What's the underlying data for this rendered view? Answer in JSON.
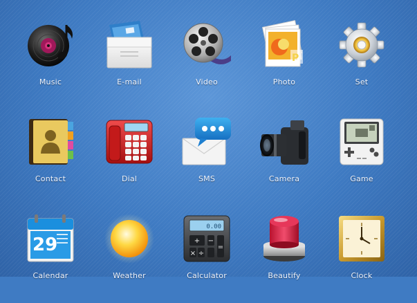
{
  "apps": [
    {
      "label": "Music",
      "icon": "music-disc-icon"
    },
    {
      "label": "E-mail",
      "icon": "envelope-icon"
    },
    {
      "label": "Video",
      "icon": "film-reel-icon"
    },
    {
      "label": "Photo",
      "icon": "photo-stack-icon"
    },
    {
      "label": "Set",
      "icon": "gear-icon"
    },
    {
      "label": "Contact",
      "icon": "address-book-icon"
    },
    {
      "label": "Dial",
      "icon": "telephone-icon"
    },
    {
      "label": "SMS",
      "icon": "message-bubble-icon"
    },
    {
      "label": "Camera",
      "icon": "camera-icon"
    },
    {
      "label": "Game",
      "icon": "handheld-console-icon"
    },
    {
      "label": "Calendar",
      "icon": "calendar-icon"
    },
    {
      "label": "Weather",
      "icon": "sun-icon"
    },
    {
      "label": "Calculator",
      "icon": "calculator-icon"
    },
    {
      "label": "Beautify",
      "icon": "red-button-icon"
    },
    {
      "label": "Clock",
      "icon": "clock-icon"
    }
  ],
  "icon_text": {
    "calendar_day": "29",
    "calculator_display": "0.00"
  },
  "colors": {
    "background": "#3f7bc3",
    "label_text": "#eef4ff"
  }
}
